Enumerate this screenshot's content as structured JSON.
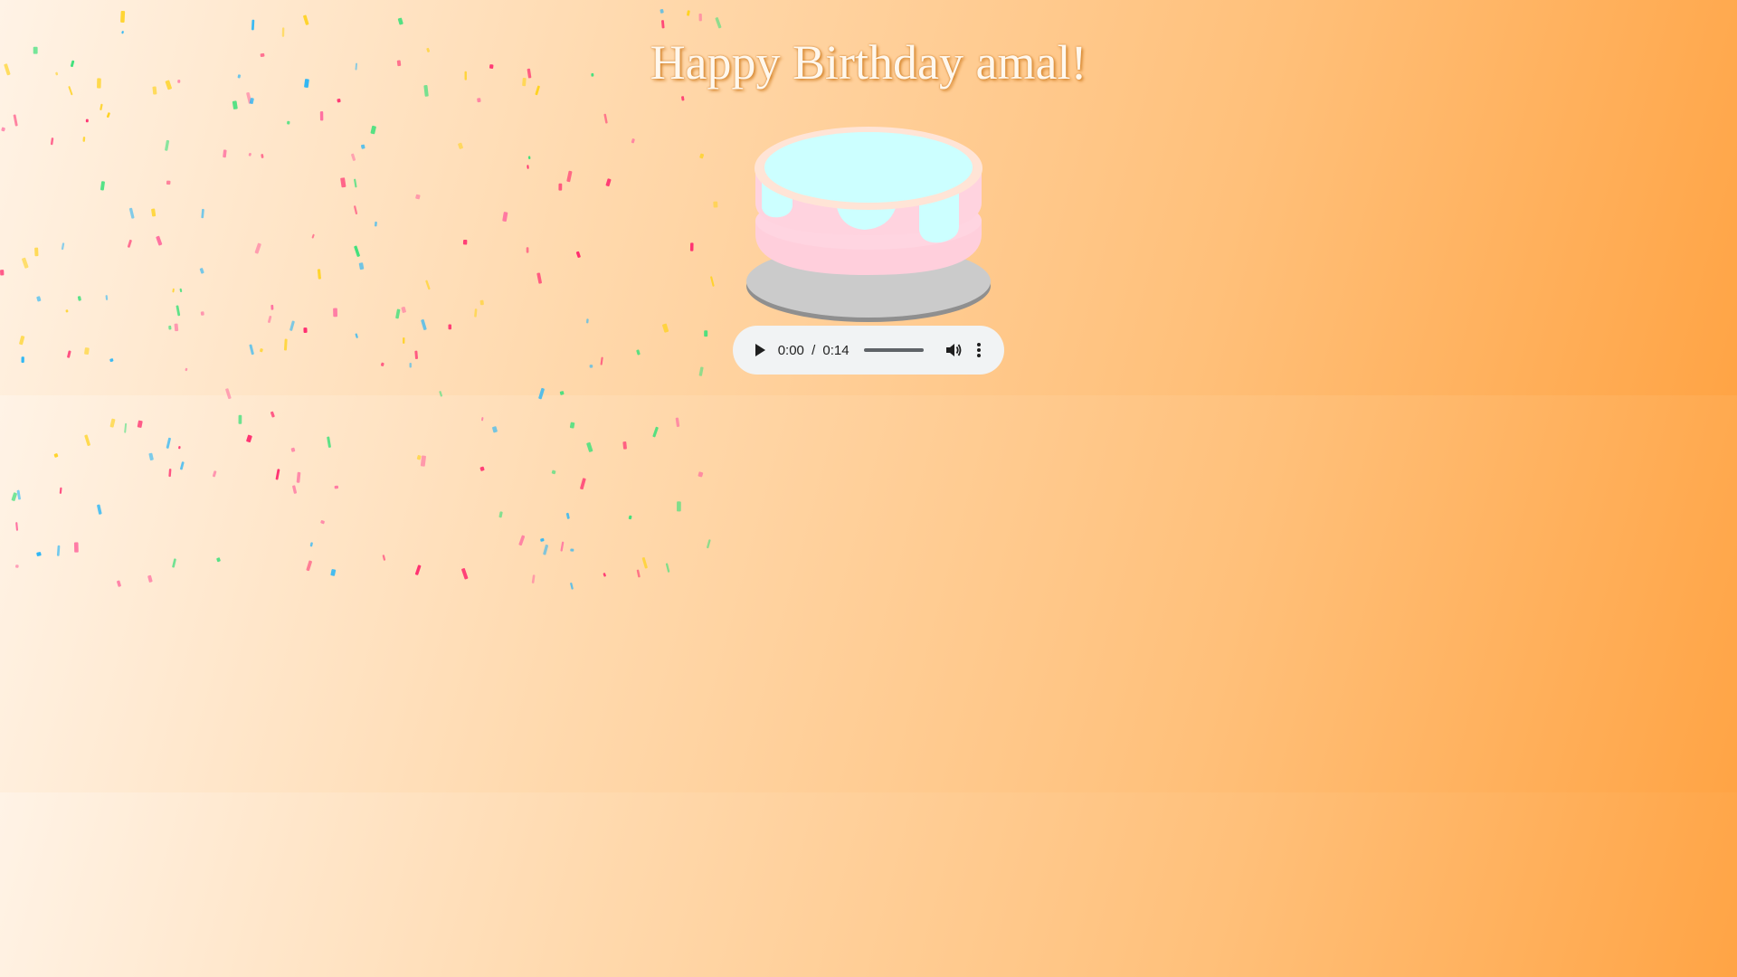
{
  "page": {
    "title": "Happy Birthday amal!"
  },
  "cake": {
    "icing_color": "#ccffff",
    "body_color": "#ffd1dc",
    "plate_color": "#c9c9c9"
  },
  "audio": {
    "current_time": "0:00",
    "separator": "/",
    "duration": "0:14",
    "play_icon": "play-icon",
    "volume_icon": "volume-icon",
    "more_icon": "more-vert-icon"
  },
  "confetti": {
    "colors": [
      "#ff2d6f",
      "#ff6fa0",
      "#2bb5f5",
      "#3ee07a",
      "#ffd21f"
    ]
  }
}
